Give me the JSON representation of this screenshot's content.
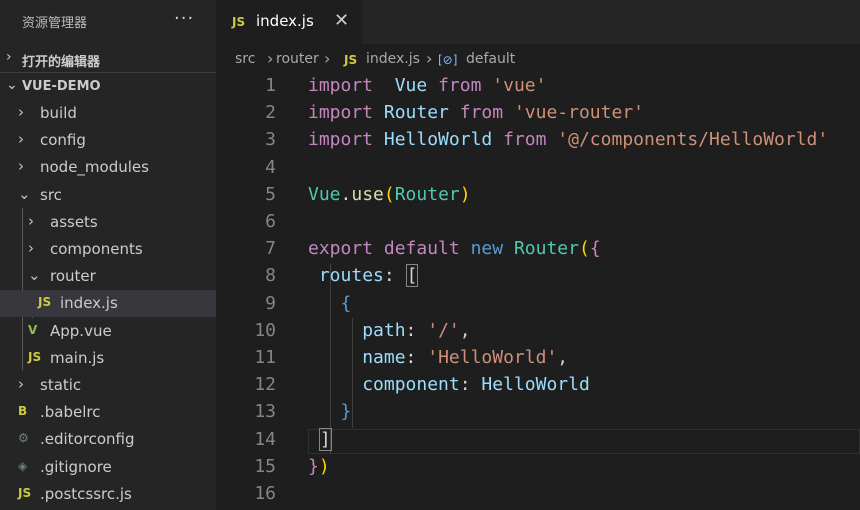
{
  "sidebar": {
    "title": "资源管理器",
    "more": "···",
    "open_editors": "打开的编辑器",
    "project": "VUE-DEMO",
    "tree": [
      {
        "label": "build",
        "kind": "folder",
        "expanded": false
      },
      {
        "label": "config",
        "kind": "folder",
        "expanded": false
      },
      {
        "label": "node_modules",
        "kind": "folder",
        "expanded": false
      },
      {
        "label": "src",
        "kind": "folder",
        "expanded": true
      },
      {
        "label": "assets",
        "kind": "folder",
        "expanded": false
      },
      {
        "label": "components",
        "kind": "folder",
        "expanded": false
      },
      {
        "label": "router",
        "kind": "folder",
        "expanded": true
      },
      {
        "label": "index.js",
        "kind": "js",
        "selected": true
      },
      {
        "label": "App.vue",
        "kind": "vue"
      },
      {
        "label": "main.js",
        "kind": "js"
      },
      {
        "label": "static",
        "kind": "folder",
        "expanded": false
      },
      {
        "label": ".babelrc",
        "kind": "babel"
      },
      {
        "label": ".editorconfig",
        "kind": "gear"
      },
      {
        "label": ".gitignore",
        "kind": "git"
      },
      {
        "label": ".postcssrc.js",
        "kind": "js"
      }
    ]
  },
  "tab": {
    "icon": "JS",
    "label": "index.js",
    "close": "✕"
  },
  "breadcrumb": {
    "parts": [
      "src",
      "router",
      "index.js",
      "default"
    ],
    "js_icon": "JS",
    "symbol_icon": "[⊘]"
  },
  "icons": {
    "js": "JS",
    "vue": "V",
    "babel": "B",
    "gear": "⚙",
    "git": "◈",
    "chevron_right": "›",
    "chevron_down": "⌄"
  },
  "colors": {
    "js": "#cbcb41",
    "vue": "#8dc149",
    "babel": "#cbcb41",
    "gear": "#6d8086",
    "git": "#6d8086",
    "keyword": "#c586c0",
    "string": "#ce9178",
    "class": "#4ec9b0"
  },
  "code": {
    "line_numbers": [
      "1",
      "2",
      "3",
      "4",
      "5",
      "6",
      "7",
      "8",
      "9",
      "10",
      "11",
      "12",
      "13",
      "14",
      "15",
      "16"
    ],
    "lines": [
      [
        [
          "kw",
          "import"
        ],
        [
          "",
          "  "
        ],
        [
          "var",
          "Vue"
        ],
        [
          "",
          " "
        ],
        [
          "kw",
          "from"
        ],
        [
          "",
          " "
        ],
        [
          "str",
          "'vue'"
        ]
      ],
      [
        [
          "kw",
          "import"
        ],
        [
          "",
          " "
        ],
        [
          "var",
          "Router"
        ],
        [
          "",
          " "
        ],
        [
          "kw",
          "from"
        ],
        [
          "",
          " "
        ],
        [
          "str",
          "'vue-router'"
        ]
      ],
      [
        [
          "kw",
          "import"
        ],
        [
          "",
          " "
        ],
        [
          "var",
          "HelloWorld"
        ],
        [
          "",
          " "
        ],
        [
          "kw",
          "from"
        ],
        [
          "",
          " "
        ],
        [
          "str",
          "'@/components/HelloWorld'"
        ]
      ],
      [],
      [
        [
          "cls",
          "Vue"
        ],
        [
          "",
          "."
        ],
        [
          "fn",
          "use"
        ],
        [
          "br",
          "("
        ],
        [
          "cls",
          "Router"
        ],
        [
          "br",
          ")"
        ]
      ],
      [],
      [
        [
          "kw",
          "export"
        ],
        [
          "",
          " "
        ],
        [
          "kw",
          "default"
        ],
        [
          "",
          " "
        ],
        [
          "kw2",
          "new"
        ],
        [
          "",
          " "
        ],
        [
          "cls",
          "Router"
        ],
        [
          "br",
          "("
        ],
        [
          "kw",
          "{"
        ]
      ],
      [
        [
          "",
          " "
        ],
        [
          "var",
          "routes"
        ],
        [
          "",
          ": "
        ],
        [
          "bm",
          "["
        ]
      ],
      [
        [
          "",
          "   "
        ],
        [
          "kw2",
          "{"
        ]
      ],
      [
        [
          "",
          "     "
        ],
        [
          "var",
          "path"
        ],
        [
          "",
          ": "
        ],
        [
          "str",
          "'/'"
        ],
        [
          "",
          ","
        ]
      ],
      [
        [
          "",
          "     "
        ],
        [
          "var",
          "name"
        ],
        [
          "",
          ": "
        ],
        [
          "str",
          "'HelloWorld'"
        ],
        [
          "",
          ","
        ]
      ],
      [
        [
          "",
          "     "
        ],
        [
          "var",
          "component"
        ],
        [
          "",
          ": "
        ],
        [
          "var",
          "HelloWorld"
        ]
      ],
      [
        [
          "",
          "   "
        ],
        [
          "kw2",
          "}"
        ]
      ],
      [
        [
          "",
          " "
        ],
        [
          "bm",
          "]"
        ]
      ],
      [
        [
          "kw",
          "}"
        ],
        [
          "br",
          ")"
        ]
      ],
      []
    ]
  }
}
